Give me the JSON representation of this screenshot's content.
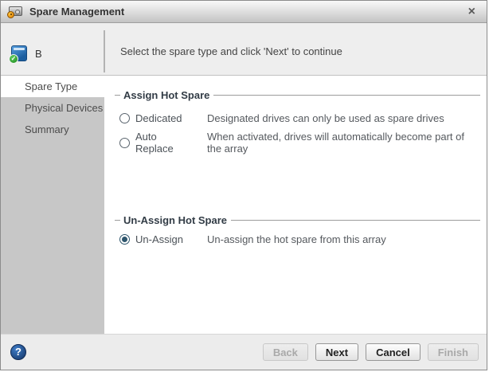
{
  "window": {
    "title": "Spare Management",
    "close_glyph": "×"
  },
  "header": {
    "device_label": "B",
    "device_status_glyph": "✓",
    "instruction": "Select the spare type and click 'Next' to continue"
  },
  "sidebar": {
    "items": [
      {
        "label": "Spare Type",
        "selected": true
      },
      {
        "label": "Physical Devices",
        "selected": false
      },
      {
        "label": "Summary",
        "selected": false
      }
    ]
  },
  "sections": [
    {
      "legend": "Assign Hot Spare",
      "options": [
        {
          "label": "Dedicated",
          "selected": false,
          "description": "Designated drives can only be used as spare drives"
        },
        {
          "label": "Auto Replace",
          "selected": false,
          "description": "When activated, drives will automatically become part of the array"
        }
      ]
    },
    {
      "legend": "Un-Assign Hot Spare",
      "options": [
        {
          "label": "Un-Assign",
          "selected": true,
          "description": "Un-assign the hot spare from this array"
        }
      ]
    }
  ],
  "footer": {
    "help_glyph": "?",
    "buttons": [
      {
        "label": "Back",
        "enabled": false
      },
      {
        "label": "Next",
        "enabled": true
      },
      {
        "label": "Cancel",
        "enabled": true
      },
      {
        "label": "Finish",
        "enabled": false
      }
    ]
  },
  "colors": {
    "radio_accent": "#2e566d",
    "help_blue": "#143465",
    "sidebar_gray": "#c7c7c7",
    "selected_item_bg": "#ffffff",
    "device_icon_blue": "#1c5e9f",
    "status_green": "#1d8a1d"
  }
}
